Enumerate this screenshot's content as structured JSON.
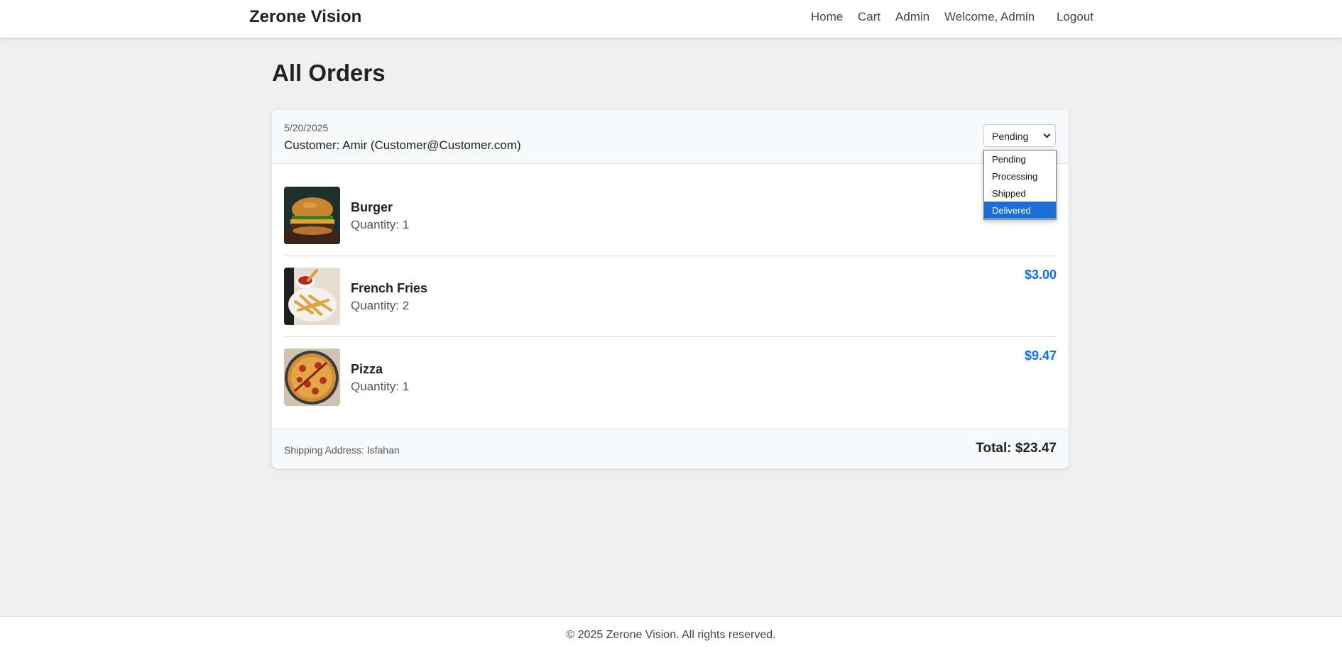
{
  "header": {
    "brand": "Zerone Vision",
    "nav": {
      "home": "Home",
      "cart": "Cart",
      "admin": "Admin",
      "welcome": "Welcome, Admin",
      "logout": "Logout"
    }
  },
  "page": {
    "title": "All Orders"
  },
  "order": {
    "date": "5/20/2025",
    "customer": "Customer: Amir (Customer@Customer.com)",
    "status": {
      "selected": "Pending",
      "options": [
        "Pending",
        "Processing",
        "Shipped",
        "Delivered"
      ],
      "highlighted": "Delivered"
    },
    "items": [
      {
        "name": "Burger",
        "quantity": "Quantity: 1",
        "price": ""
      },
      {
        "name": "French Fries",
        "quantity": "Quantity: 2",
        "price": "$3.00"
      },
      {
        "name": "Pizza",
        "quantity": "Quantity: 1",
        "price": "$9.47"
      }
    ],
    "shipping": "Shipping Address: Isfahan",
    "total": "Total: $23.47"
  },
  "footer": {
    "copyright": "© 2025 Zerone Vision. All rights reserved."
  },
  "colors": {
    "accent": "#0d6efd",
    "highlight": "#1a6fd6",
    "background": "#efefef"
  }
}
